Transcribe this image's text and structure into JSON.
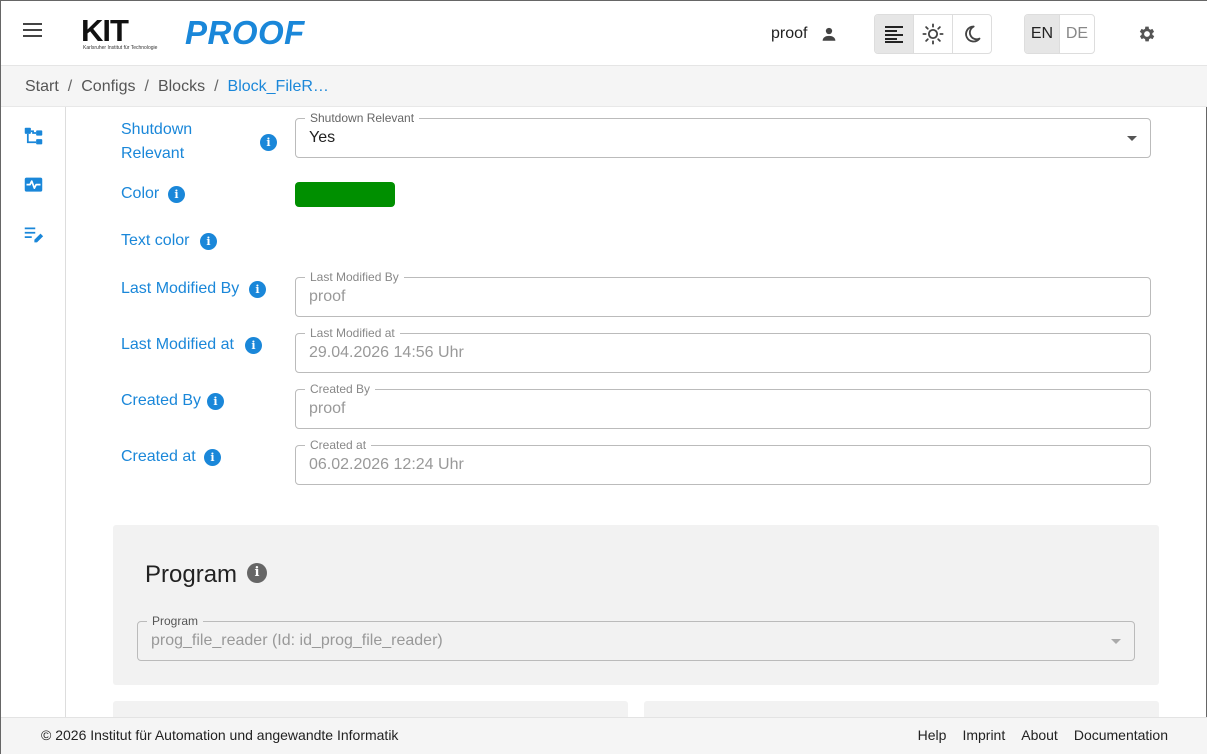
{
  "header": {
    "logo_text": "KIT",
    "logo_subtitle": "Karlsruher Institut für Technologie",
    "brand": "PROOF",
    "username": "proof",
    "languages": [
      {
        "label": "EN",
        "active": true
      },
      {
        "label": "DE",
        "active": false
      }
    ],
    "theme_modes": [
      "text-mode-icon",
      "light-mode-icon",
      "dark-mode-icon"
    ]
  },
  "breadcrumb": {
    "items": [
      "Start",
      "Configs",
      "Blocks"
    ],
    "current": "Block_FileR…",
    "separator": "/"
  },
  "sidebar": {
    "icons": [
      "tree-icon",
      "monitor-icon",
      "edit-list-icon"
    ]
  },
  "form": {
    "shutdown_relevant": {
      "label": "Shutdown Relevant",
      "legend": "Shutdown Relevant",
      "value": "Yes"
    },
    "color": {
      "label": "Color",
      "value": "#008f00"
    },
    "text_color": {
      "label": "Text color",
      "value": "#ffffff"
    },
    "last_modified_by": {
      "label": "Last Modified By",
      "legend": "Last Modified By",
      "value": "proof"
    },
    "last_modified_at": {
      "label": "Last Modified at",
      "legend": "Last Modified at",
      "value": "29.04.2026 14:56 Uhr"
    },
    "created_by": {
      "label": "Created By",
      "legend": "Created By",
      "value": "proof"
    },
    "created_at": {
      "label": "Created at",
      "legend": "Created at",
      "value": "06.02.2026 12:24 Uhr"
    }
  },
  "program": {
    "title": "Program",
    "legend": "Program",
    "value": "prog_file_reader (Id: id_prog_file_reader)"
  },
  "footer": {
    "copyright": "© 2026 Institut für Automation und angewandte Informatik",
    "links": [
      "Help",
      "Imprint",
      "About",
      "Documentation"
    ]
  },
  "colors": {
    "accent": "#1a87d9",
    "swatch_color": "#008f00"
  }
}
